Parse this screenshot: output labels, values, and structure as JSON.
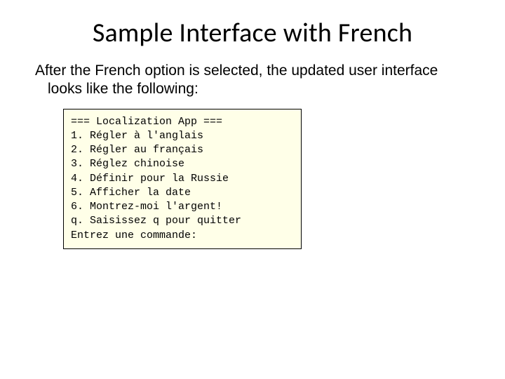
{
  "title": "Sample Interface with French",
  "body": "After the French option is selected, the updated user\n  interface looks like the following:",
  "code": {
    "header": "=== Localization App ===",
    "lines": [
      "1. Régler à l'anglais",
      "2. Régler au français",
      "3. Réglez chinoise",
      "4. Définir pour la Russie",
      "5. Afficher la date",
      "6. Montrez-moi l'argent!",
      "q. Saisissez q pour quitter"
    ],
    "prompt": "Entrez une commande:"
  }
}
